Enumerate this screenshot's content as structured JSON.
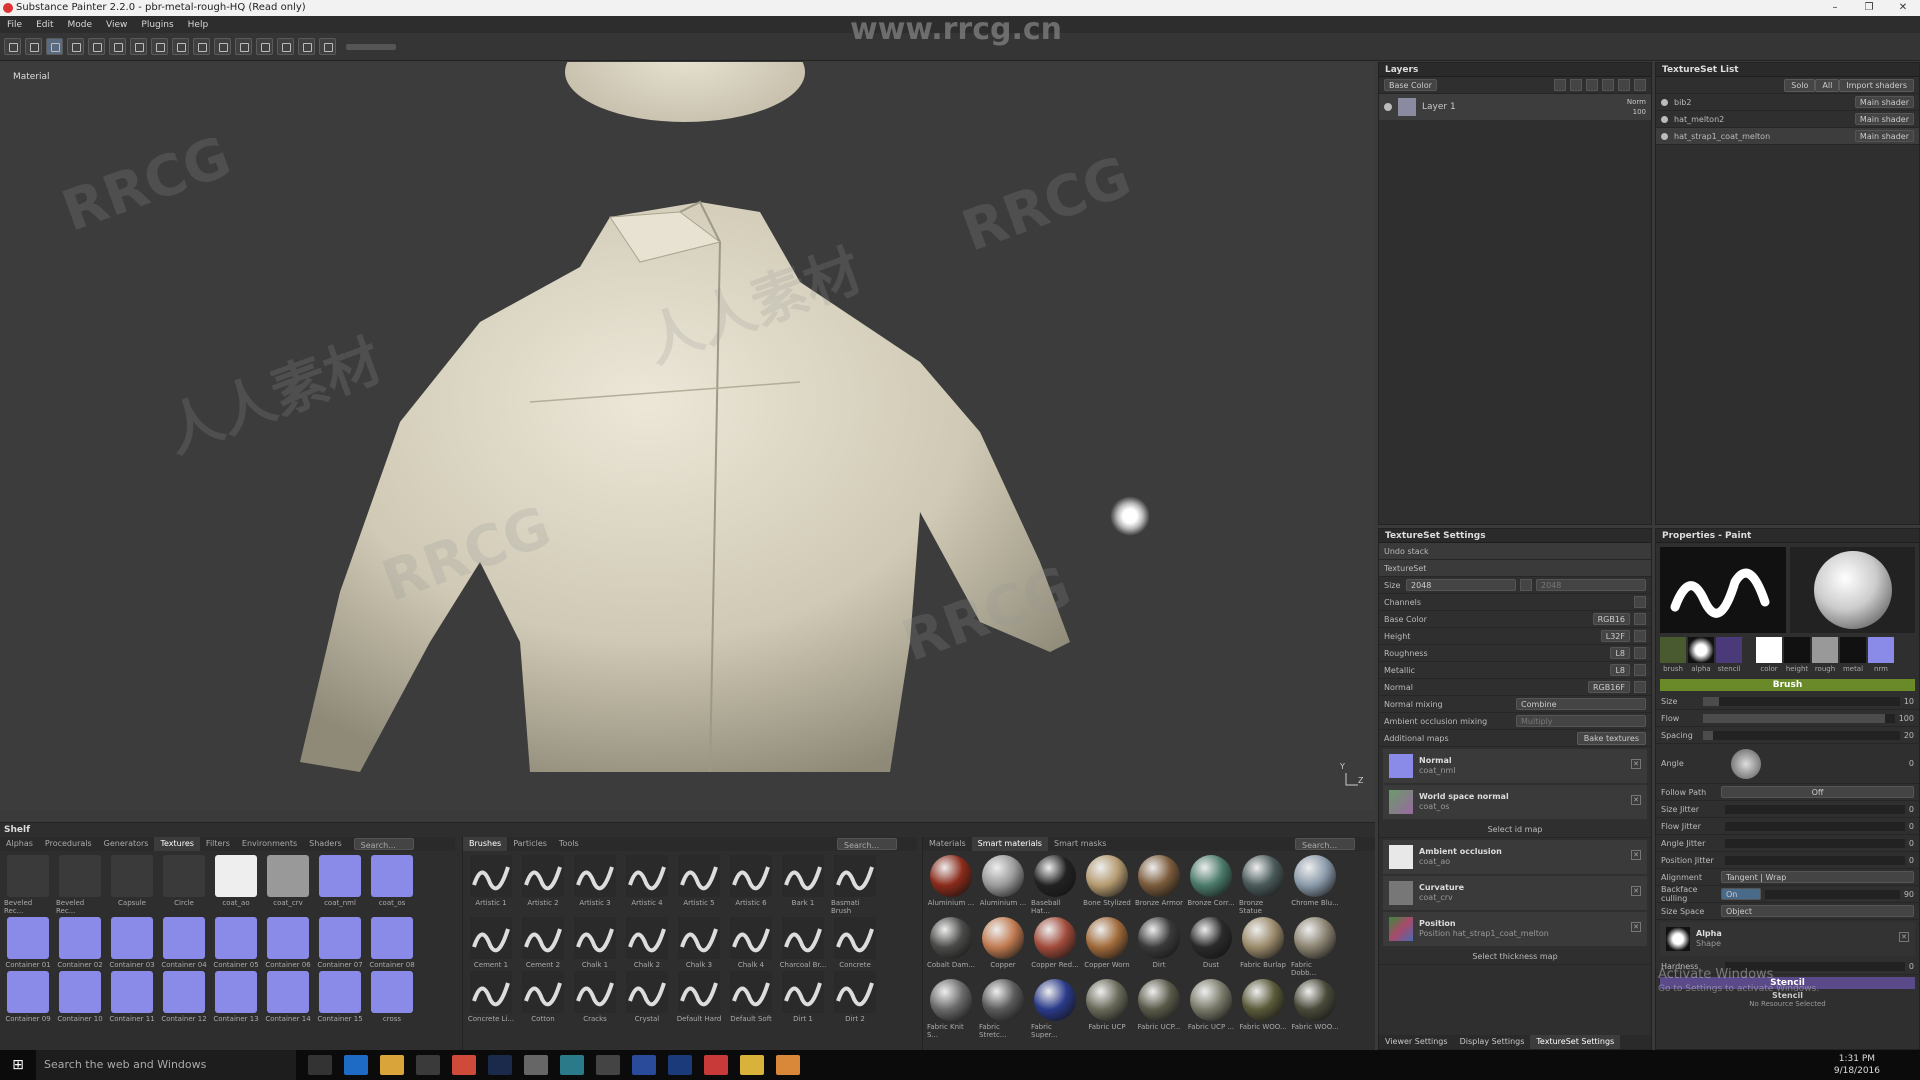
{
  "window": {
    "title": "Substance Painter 2.2.0 - pbr-metal-rough-HQ (Read only)",
    "minimize": "–",
    "maximize": "❐",
    "close": "✕"
  },
  "menu": [
    "File",
    "Edit",
    "Mode",
    "View",
    "Plugins",
    "Help"
  ],
  "watermark": {
    "url": "www.rrcg.cn",
    "mark1": "RRCG",
    "mark2": "人人素材",
    "activate1": "Activate Windows",
    "activate2": "Go to Settings to activate Windows."
  },
  "viewport": {
    "label": "Material",
    "axis_y": "Y",
    "axis_z": "Z"
  },
  "layers": {
    "title": "Layers",
    "channel": "Base Color",
    "layer_name": "Layer 1",
    "blend": "Norm",
    "opacity": "100"
  },
  "texset_list": {
    "title": "TextureSet List",
    "solo": "Solo",
    "all": "All",
    "import": "Import shaders",
    "items": [
      {
        "name": "bib2",
        "shader": "Main shader"
      },
      {
        "name": "hat_melton2",
        "shader": "Main shader"
      },
      {
        "name": "hat_strap1_coat_melton",
        "shader": "Main shader"
      }
    ]
  },
  "tss": {
    "title": "TextureSet Settings",
    "undo": "Undo stack",
    "textureset": "TextureSet",
    "size_label": "Size",
    "size": "2048",
    "size2": "2048",
    "channels_label": "Channels",
    "channels": [
      {
        "name": "Base Color",
        "fmt": "RGB16"
      },
      {
        "name": "Height",
        "fmt": "L32F"
      },
      {
        "name": "Roughness",
        "fmt": "L8"
      },
      {
        "name": "Metallic",
        "fmt": "L8"
      },
      {
        "name": "Normal",
        "fmt": "RGB16F"
      }
    ],
    "normal_mixing_label": "Normal mixing",
    "normal_mixing": "Combine",
    "ao_mixing_label": "Ambient occlusion mixing",
    "ao_mixing": "Multiply",
    "additional": "Additional maps",
    "bake": "Bake textures",
    "maps": [
      {
        "name": "Normal",
        "file": "coat_nml"
      },
      {
        "name": "World space normal",
        "file": "coat_os"
      }
    ],
    "select_id": "Select id map",
    "maps2": [
      {
        "name": "Ambient occlusion",
        "file": "coat_ao"
      },
      {
        "name": "Curvature",
        "file": "coat_crv"
      },
      {
        "name": "Position",
        "file": "Position hat_strap1_coat_melton"
      }
    ],
    "select_thick": "Select thickness map",
    "bottom_tabs": [
      "Viewer Settings",
      "Display Settings",
      "TextureSet Settings"
    ]
  },
  "props": {
    "title": "Properties - Paint",
    "thumbs": [
      "brush",
      "alpha",
      "stencil"
    ],
    "mats": [
      "color",
      "height",
      "rough",
      "metal",
      "nrm"
    ],
    "brush": "Brush",
    "size_label": "Size",
    "size": "10",
    "size_fill": 0.08,
    "flow_label": "Flow",
    "flow": "100",
    "flow_fill": 0.95,
    "spacing_label": "Spacing",
    "spacing": "20",
    "spacing_fill": 0.05,
    "angle_label": "Angle",
    "angle": "0",
    "follow_label": "Follow Path",
    "follow": "Off",
    "jitters": [
      {
        "label": "Size Jitter",
        "value": "0"
      },
      {
        "label": "Flow Jitter",
        "value": "0"
      },
      {
        "label": "Angle Jitter",
        "value": "0"
      },
      {
        "label": "Position Jitter",
        "value": "0"
      }
    ],
    "alignment_label": "Alignment",
    "alignment": "Tangent | Wrap",
    "backface_label": "Backface culling",
    "backface": "On",
    "backface_val": "90",
    "sizespace_label": "Size Space",
    "sizespace": "Object",
    "alpha": "Alpha",
    "alpha_sub": "Shape",
    "hardness_label": "Hardness",
    "hardness": "0",
    "stencil": "Stencil",
    "stencil2": "Stencil",
    "no_res": "No Resource Selected"
  },
  "shelf": {
    "title": "Shelf",
    "tabs": [
      "Alphas",
      "Procedurals",
      "Generators",
      "Textures",
      "Filters",
      "Environments",
      "Shaders"
    ],
    "search": "Search...",
    "items": [
      "Beveled Rec...",
      "Beveled Rec...",
      "Capsule",
      "Circle",
      "coat_ao",
      "coat_crv",
      "coat_nml",
      "coat_os",
      "Container 01",
      "Container 02",
      "Container 03",
      "Container 04",
      "Container 05",
      "Container 06",
      "Container 07",
      "Container 08",
      "Container 09",
      "Container 10",
      "Container 11",
      "Container 12",
      "Container 13",
      "Container 14",
      "Container 15",
      "cross"
    ]
  },
  "brushes": {
    "tabs": [
      "Brushes",
      "Particles",
      "Tools"
    ],
    "search": "Search...",
    "items": [
      "Artistic 1",
      "Artistic 2",
      "Artistic 3",
      "Artistic 4",
      "Artistic 5",
      "Artistic 6",
      "Bark 1",
      "Basmati Brush",
      "Cement 1",
      "Cement 2",
      "Chalk 1",
      "Chalk 2",
      "Chalk 3",
      "Chalk 4",
      "Charcoal Br...",
      "Concrete",
      "Concrete Li...",
      "Cotton",
      "Cracks",
      "Crystal",
      "Default Hard",
      "Default Soft",
      "Dirt 1",
      "Dirt 2"
    ]
  },
  "materials": {
    "tabs": [
      "Materials",
      "Smart materials",
      "Smart masks"
    ],
    "search": "Search...",
    "items": [
      {
        "n": "Aluminium ...",
        "c": "#8a2a1a"
      },
      {
        "n": "Aluminium ...",
        "c": "#9a9a9a"
      },
      {
        "n": "Baseball Hat...",
        "c": "#222"
      },
      {
        "n": "Bone Stylized",
        "c": "#b49a70"
      },
      {
        "n": "Bronze Armor",
        "c": "#7a5a3a"
      },
      {
        "n": "Bronze Corr...",
        "c": "#4a7a6a"
      },
      {
        "n": "Bronze Statue",
        "c": "#4a5a5a"
      },
      {
        "n": "Chrome Blu...",
        "c": "#8a9aaa"
      },
      {
        "n": "Cobalt Dam...",
        "c": "#4a4a48"
      },
      {
        "n": "Copper",
        "c": "#c07a50"
      },
      {
        "n": "Copper Red...",
        "c": "#a04a3a"
      },
      {
        "n": "Copper Worn",
        "c": "#a06a3a"
      },
      {
        "n": "Dirt",
        "c": "#3a3a3a"
      },
      {
        "n": "Dust",
        "c": "#2a2a2a"
      },
      {
        "n": "Fabric Burlap",
        "c": "#9a8a6a"
      },
      {
        "n": "Fabric Dobb...",
        "c": "#8a8270"
      },
      {
        "n": "Fabric Knit S...",
        "c": "#6a6a6a"
      },
      {
        "n": "Fabric Stretc...",
        "c": "#5a5a5a"
      },
      {
        "n": "Fabric Super...",
        "c": "#2a3a8a"
      },
      {
        "n": "Fabric UCP",
        "c": "#6a6a5a"
      },
      {
        "n": "Fabric UCP...",
        "c": "#5a5a4a"
      },
      {
        "n": "Fabric UCP ...",
        "c": "#7a7a6a"
      },
      {
        "n": "Fabric WOO...",
        "c": "#5a5a3a"
      },
      {
        "n": "Fabric WOO...",
        "c": "#4a4a3a"
      }
    ]
  },
  "taskbar": {
    "search": "Search the web and Windows",
    "time": "1:31 PM",
    "date": "9/18/2016"
  }
}
